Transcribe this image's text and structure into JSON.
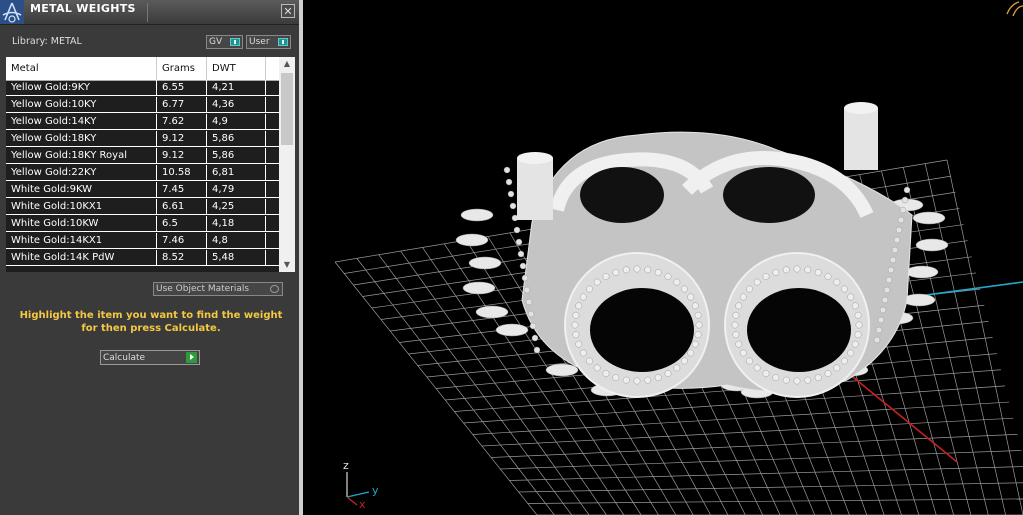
{
  "panel": {
    "title": "METAL WEIGHTS",
    "close_glyph": "✕",
    "library_label": "Library: METAL",
    "toggles": [
      {
        "label": "GV"
      },
      {
        "label": "User"
      }
    ],
    "table": {
      "columns": [
        "Metal",
        "Grams",
        "DWT"
      ],
      "rows": [
        {
          "metal": "Yellow Gold:9KY",
          "grams": "6.55",
          "dwt": "4,21"
        },
        {
          "metal": "Yellow Gold:10KY",
          "grams": "6.77",
          "dwt": "4,36"
        },
        {
          "metal": "Yellow Gold:14KY",
          "grams": "7.62",
          "dwt": "4,9"
        },
        {
          "metal": "Yellow Gold:18KY",
          "grams": "9.12",
          "dwt": "5,86"
        },
        {
          "metal": "Yellow Gold:18KY Royal",
          "grams": "9.12",
          "dwt": "5,86"
        },
        {
          "metal": "Yellow Gold:22KY",
          "grams": "10.58",
          "dwt": "6,81"
        },
        {
          "metal": "White Gold:9KW",
          "grams": "7.45",
          "dwt": "4,79"
        },
        {
          "metal": "White Gold:10KX1",
          "grams": "6.61",
          "dwt": "4,25"
        },
        {
          "metal": "White Gold:10KW",
          "grams": "6.5",
          "dwt": "4,18"
        },
        {
          "metal": "White Gold:14KX1",
          "grams": "7.46",
          "dwt": "4,8"
        },
        {
          "metal": "White Gold:14K PdW",
          "grams": "8.52",
          "dwt": "5,48"
        }
      ]
    },
    "use_object_materials": "Use Object Materials",
    "instruction": "Highlight the item you want to find the weight for then press Calculate.",
    "calculate_label": "Calculate"
  },
  "viewport": {
    "axis_labels": {
      "z": "z",
      "y": "y",
      "x": "x"
    },
    "colors": {
      "grid": "#9a9a9a",
      "x_axis": "#c62020",
      "y_axis": "#20a8c8",
      "model": "#d6d6d6"
    }
  }
}
